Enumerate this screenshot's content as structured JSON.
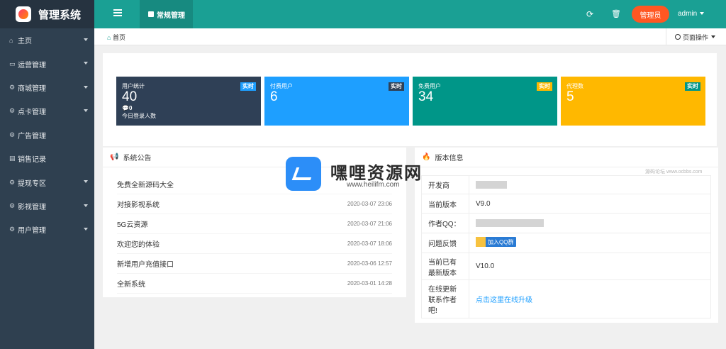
{
  "app": {
    "title": "管理系统"
  },
  "sidebar": {
    "items": [
      {
        "label": "主页",
        "icon": "home-icon",
        "has_arrow": true
      },
      {
        "label": "运营管理",
        "icon": "window-icon",
        "has_arrow": true
      },
      {
        "label": "商城管理",
        "icon": "gears-icon",
        "has_arrow": true
      },
      {
        "label": "点卡管理",
        "icon": "gears-icon",
        "has_arrow": true
      },
      {
        "label": "广告管理",
        "icon": "gears-icon",
        "has_arrow": false
      },
      {
        "label": "销售记录",
        "icon": "file-icon",
        "has_arrow": false
      },
      {
        "label": "提现专区",
        "icon": "gears-icon",
        "has_arrow": true
      },
      {
        "label": "影视管理",
        "icon": "gears-icon",
        "has_arrow": true
      },
      {
        "label": "用户管理",
        "icon": "gears-icon",
        "has_arrow": true
      }
    ]
  },
  "topbar": {
    "tab_label": "常规管理",
    "role": "管理员",
    "user": "admin",
    "accent": "#1aa094",
    "role_color": "#ff5722"
  },
  "breadcrumb": {
    "home": "首页",
    "page_ops": "页面操作"
  },
  "stats": [
    {
      "label": "用户统计",
      "value": "40",
      "tag": "实时",
      "sub1": "0",
      "sub2": "今日登录人数",
      "bg": "#2f4056",
      "tag_bg": "#1e9fff"
    },
    {
      "label": "付费用户",
      "value": "6",
      "tag": "实时",
      "bg": "#1e9fff",
      "tag_bg": "#2f4056"
    },
    {
      "label": "免费用户",
      "value": "34",
      "tag": "实时",
      "bg": "#009688",
      "tag_bg": "#ffb800"
    },
    {
      "label": "代理数",
      "value": "5",
      "tag": "实时",
      "bg": "#ffb800",
      "tag_bg": "#009688"
    }
  ],
  "notice": {
    "title": "系统公告",
    "items": [
      {
        "title": "免费全新源码大全",
        "date": ""
      },
      {
        "title": "对接影视系统",
        "date": "2020-03-07 23:06"
      },
      {
        "title": "5G云资源",
        "date": "2020-03-07 21:06"
      },
      {
        "title": "欢迎您的体验",
        "date": "2020-03-07 18:06"
      },
      {
        "title": "新增用户充值接口",
        "date": "2020-03-06 12:57"
      },
      {
        "title": "全新系统",
        "date": "2020-03-01 14:28"
      }
    ]
  },
  "version": {
    "title": "版本信息",
    "rows": [
      {
        "key": "开发商",
        "value": ""
      },
      {
        "key": "当前版本",
        "value": "V9.0"
      },
      {
        "key": "作者QQ：",
        "value": ""
      },
      {
        "key": "问题反馈",
        "value": "加入QQ群"
      },
      {
        "key": "当前已有最新版本",
        "value": "V10.0"
      },
      {
        "key": "在线更新联系作者吧!",
        "value": "点击这里在线升级"
      }
    ]
  },
  "watermark": {
    "title": "嘿哩资源网",
    "url": "www.heilifm.com",
    "small": "源码论坛 www.ocbbs.com"
  }
}
